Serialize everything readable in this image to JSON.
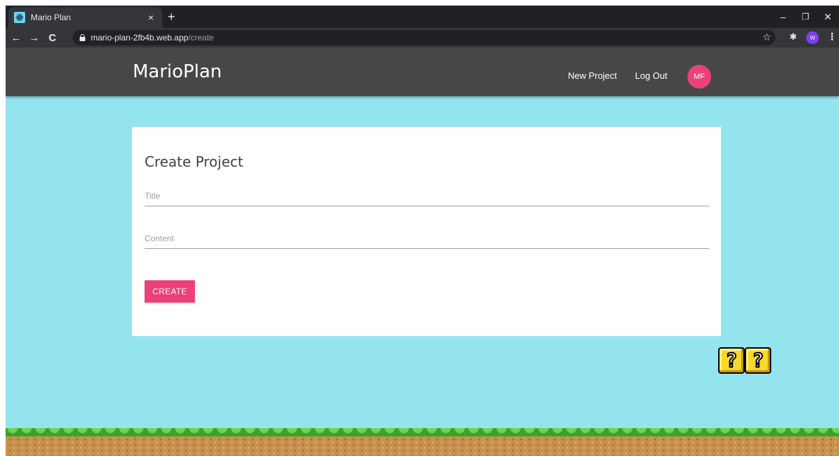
{
  "browser": {
    "tab_title": "Mario Plan",
    "tab_close": "×",
    "new_tab": "+",
    "url_host": "mario-plan-2fb4b.web.app",
    "url_path": "/create",
    "profile_initial": "W",
    "window_controls": {
      "minimize": "–",
      "maximize": "❐",
      "close": "✕"
    },
    "nav": {
      "back": "←",
      "forward": "→",
      "reload": "C"
    },
    "star": "☆",
    "extensions": "✱",
    "menu": "⋮"
  },
  "navbar": {
    "brand": "MarioPlan",
    "links": [
      {
        "label": "New Project"
      },
      {
        "label": "Log Out"
      }
    ],
    "avatar_initials": "MF",
    "accent_color": "#ec407a",
    "bar_color": "#474747"
  },
  "form": {
    "heading": "Create Project",
    "title_placeholder": "Title",
    "content_placeholder": "Content",
    "submit_label": "CREATE"
  },
  "decor": {
    "block_symbol": "?",
    "background_color": "#94e4f0"
  }
}
